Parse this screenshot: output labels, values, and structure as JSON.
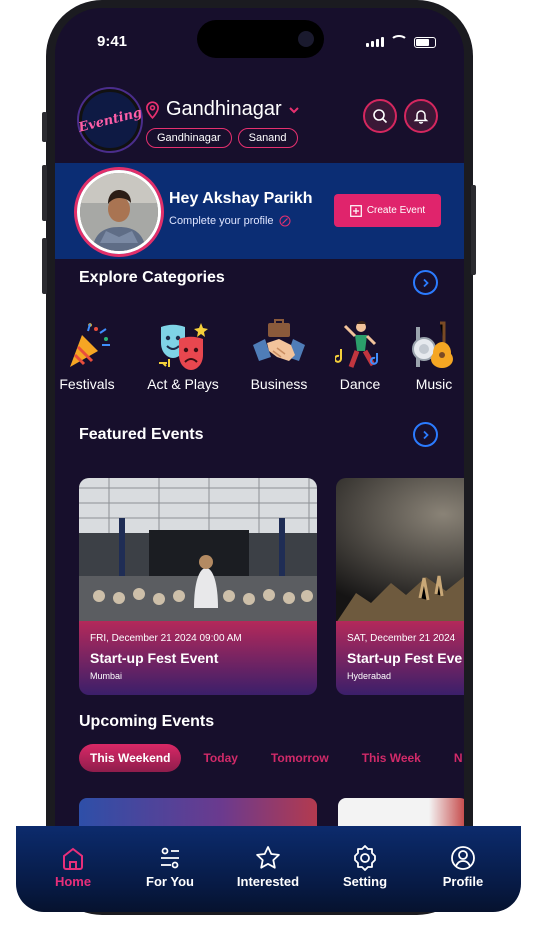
{
  "status_bar": {
    "time": "9:41"
  },
  "header": {
    "logo_text": "Eventing",
    "city": "Gandhinagar",
    "chips": [
      "Gandhinagar",
      "Sanand"
    ]
  },
  "profile_banner": {
    "greeting": "Hey Akshay Parikh",
    "subtitle": "Complete your profile",
    "create_button": "Create Event"
  },
  "categories": {
    "title": "Explore Categories",
    "items": [
      {
        "label": "Festivals",
        "icon": "party-popper-icon"
      },
      {
        "label": "Act & Plays",
        "icon": "theater-masks-icon"
      },
      {
        "label": "Business",
        "icon": "handshake-icon"
      },
      {
        "label": "Dance",
        "icon": "dancer-icon"
      },
      {
        "label": "Music",
        "icon": "instruments-icon"
      }
    ]
  },
  "featured": {
    "title": "Featured Events",
    "events": [
      {
        "date": "FRI, December 21 2024 09:00 AM",
        "name": "Start-up Fest Event",
        "place": "Mumbai"
      },
      {
        "date": "SAT, December 21 2024",
        "name": "Start-up Fest Eve",
        "place": "Hyderabad"
      }
    ]
  },
  "upcoming": {
    "title": "Upcoming Events",
    "tabs": [
      "This Weekend",
      "Today",
      "Tomorrow",
      "This Week",
      "N"
    ],
    "active_tab": "This Weekend"
  },
  "bottom_nav": {
    "items": [
      {
        "label": "Home",
        "icon": "home-icon",
        "active": true
      },
      {
        "label": "For You",
        "icon": "filter-sliders-icon",
        "active": false
      },
      {
        "label": "Interested",
        "icon": "star-icon",
        "active": false
      },
      {
        "label": "Setting",
        "icon": "gear-icon",
        "active": false
      },
      {
        "label": "Profile",
        "icon": "user-icon",
        "active": false
      }
    ]
  },
  "colors": {
    "accent": "#e0246c",
    "banner": "#0b2d74",
    "background": "#170f2c",
    "link": "#2b7bff"
  }
}
